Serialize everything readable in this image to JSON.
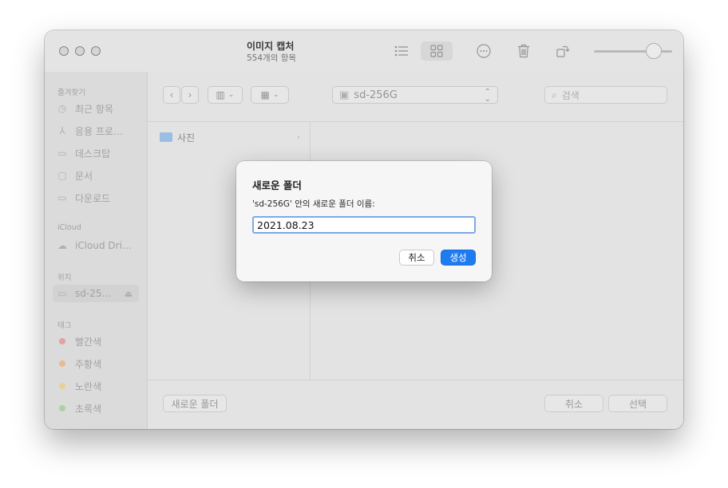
{
  "app": {
    "title": "이미지 캡처",
    "subtitle": "554개의 항목"
  },
  "sidebar": {
    "favorites_label": "즐겨찾기",
    "favorites": [
      {
        "label": "최근 항목",
        "icon": "clock-icon"
      },
      {
        "label": "응용 프로…",
        "icon": "apps-icon"
      },
      {
        "label": "데스크탑",
        "icon": "desktop-icon"
      },
      {
        "label": "문서",
        "icon": "document-icon"
      },
      {
        "label": "다운로드",
        "icon": "download-icon"
      }
    ],
    "icloud_label": "iCloud",
    "icloud": [
      {
        "label": "iCloud Dri…",
        "icon": "cloud-icon"
      }
    ],
    "locations_label": "위치",
    "locations": [
      {
        "label": "sd-25…",
        "icon": "drive-icon"
      }
    ],
    "tags_label": "태그",
    "tags": [
      {
        "label": "빨간색",
        "color": "#e9a9a6"
      },
      {
        "label": "주황색",
        "color": "#efc195"
      },
      {
        "label": "노란색",
        "color": "#eed89a"
      },
      {
        "label": "초록색",
        "color": "#b2d8aa"
      }
    ]
  },
  "browser": {
    "path_label": "sd-256G",
    "search_placeholder": "검색",
    "folders": [
      {
        "label": "사진"
      }
    ],
    "new_folder_label": "새로운 폴더",
    "cancel_label": "취소",
    "choose_label": "선택"
  },
  "dialog": {
    "title": "새로운 폴더",
    "prompt": "'sd-256G' 안의 새로운 폴더 이름:",
    "input_value": "2021.08.23",
    "cancel_label": "취소",
    "create_label": "생성",
    "accent_color": "#1f7cf0"
  }
}
